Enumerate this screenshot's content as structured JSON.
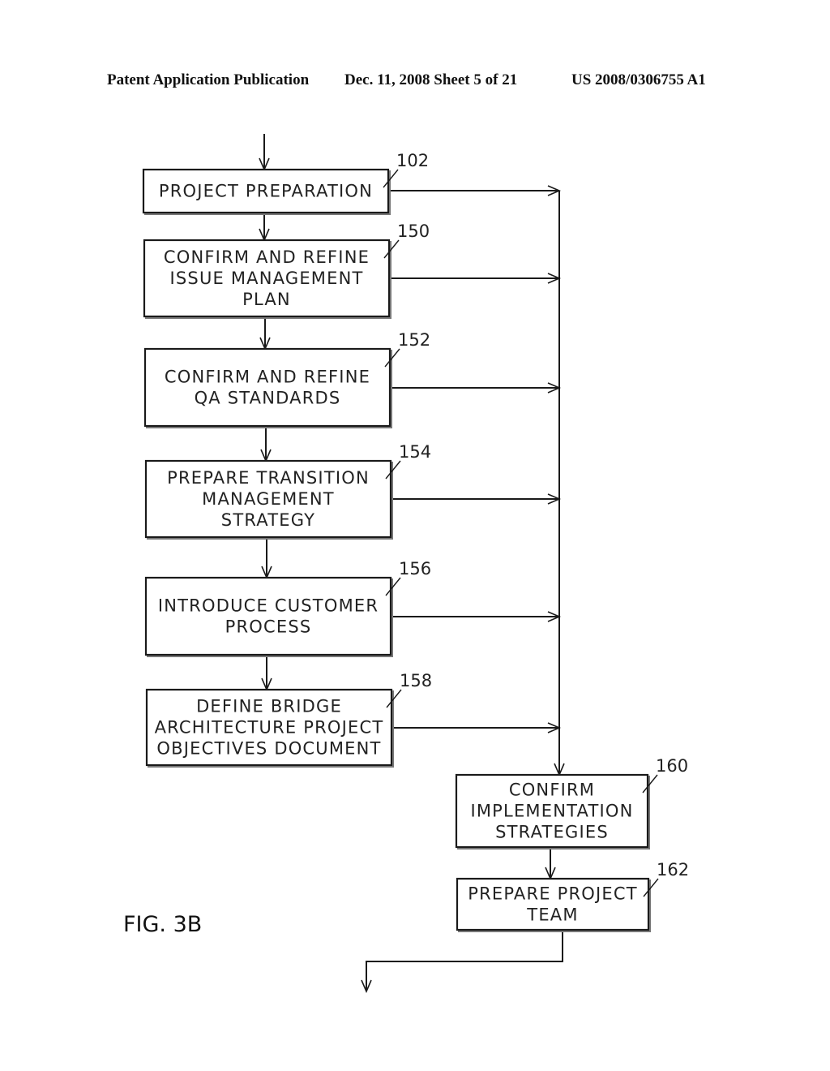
{
  "header": {
    "left": "Patent Application Publication",
    "middle": "Dec. 11, 2008   Sheet 5 of 21",
    "right": "US 2008/0306755 A1"
  },
  "figure_label": "FIG. 3B",
  "steps": [
    {
      "ref": "102",
      "lines": [
        "PROJECT PREPARATION"
      ]
    },
    {
      "ref": "150",
      "lines": [
        "CONFIRM AND REFINE",
        "ISSUE MANAGEMENT",
        "PLAN"
      ]
    },
    {
      "ref": "152",
      "lines": [
        "CONFIRM AND REFINE",
        "QA STANDARDS"
      ]
    },
    {
      "ref": "154",
      "lines": [
        "PREPARE TRANSITION",
        "MANAGEMENT",
        "STRATEGY"
      ]
    },
    {
      "ref": "156",
      "lines": [
        "INTRODUCE CUSTOMER",
        "PROCESS"
      ]
    },
    {
      "ref": "158",
      "lines": [
        "DEFINE BRIDGE",
        "ARCHITECTURE PROJECT",
        "OBJECTIVES DOCUMENT"
      ]
    },
    {
      "ref": "160",
      "lines": [
        "CONFIRM",
        "IMPLEMENTATION",
        "STRATEGIES"
      ]
    },
    {
      "ref": "162",
      "lines": [
        "PREPARE PROJECT",
        "TEAM"
      ]
    }
  ]
}
